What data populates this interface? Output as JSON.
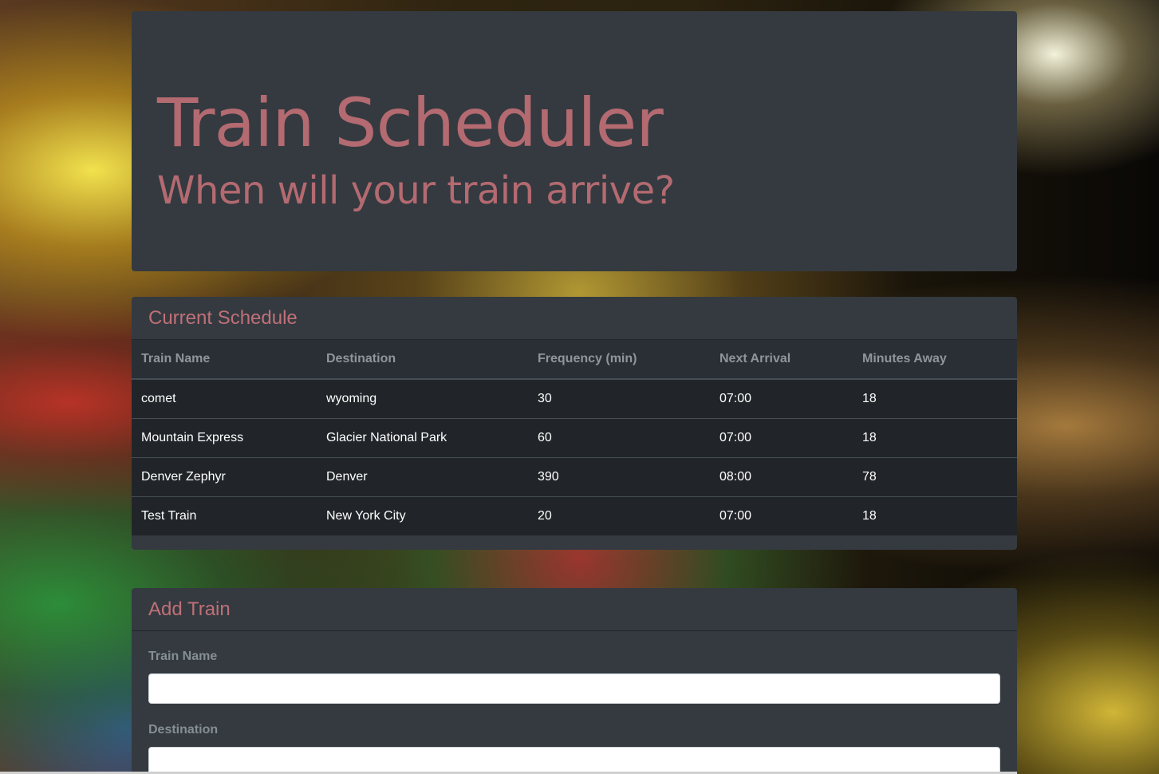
{
  "header": {
    "title": "Train Scheduler",
    "subtitle": "When will your train arrive?"
  },
  "schedule": {
    "title": "Current Schedule",
    "columns": [
      "Train Name",
      "Destination",
      "Frequency (min)",
      "Next Arrival",
      "Minutes Away"
    ],
    "rows": [
      [
        "comet",
        "wyoming",
        "30",
        "07:00",
        "18"
      ],
      [
        "Mountain Express",
        "Glacier National Park",
        "60",
        "07:00",
        "18"
      ],
      [
        "Denver Zephyr",
        "Denver",
        "390",
        "08:00",
        "78"
      ],
      [
        "Test Train",
        "New York City",
        "20",
        "07:00",
        "18"
      ]
    ]
  },
  "add_train": {
    "title": "Add Train",
    "fields": [
      {
        "label": "Train Name",
        "value": ""
      },
      {
        "label": "Destination",
        "value": ""
      }
    ]
  },
  "colors": {
    "accent": "#b36a70",
    "panel": "#343a40",
    "table_bg": "#212529"
  }
}
